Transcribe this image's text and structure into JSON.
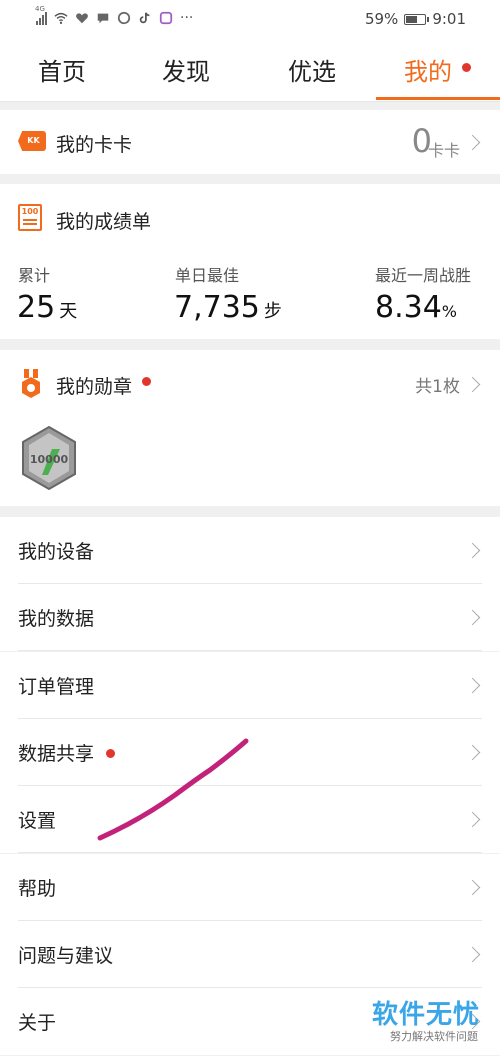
{
  "status": {
    "network_label": "4G",
    "battery_text": "59%",
    "battery_level": 0.59,
    "time": "9:01",
    "more_indicator": "···"
  },
  "tabs": [
    {
      "label": "首页",
      "active": false
    },
    {
      "label": "发现",
      "active": false
    },
    {
      "label": "优选",
      "active": false
    },
    {
      "label": "我的",
      "active": true
    }
  ],
  "card_kk": {
    "icon_text": "KK",
    "title": "我的卡卡",
    "value": "0",
    "unit": "卡卡"
  },
  "scorecard": {
    "icon_text": "100",
    "title": "我的成绩单",
    "stats": [
      {
        "label": "累计",
        "value": "25",
        "unit": "天"
      },
      {
        "label": "单日最佳",
        "value": "7,735",
        "unit": "步"
      },
      {
        "label": "最近一周战胜",
        "value": "8.34",
        "unit": "%"
      }
    ]
  },
  "medals": {
    "title": "我的勋章",
    "count": "共1枚",
    "badge_text": "10000"
  },
  "menu": [
    {
      "label": "我的设备"
    },
    {
      "label": "我的数据"
    },
    {
      "label": "订单管理"
    },
    {
      "label": "数据共享"
    },
    {
      "label": "设置"
    },
    {
      "label": "帮助"
    },
    {
      "label": "问题与建议"
    },
    {
      "label": "关于"
    }
  ],
  "watermark": {
    "main": "软件无忧",
    "sub": "努力解决软件问题"
  },
  "colors": {
    "accent": "#f26b1d",
    "red_dot": "#e0362c",
    "scribble": "#c2227a",
    "watermark": "#3aa6e8"
  }
}
